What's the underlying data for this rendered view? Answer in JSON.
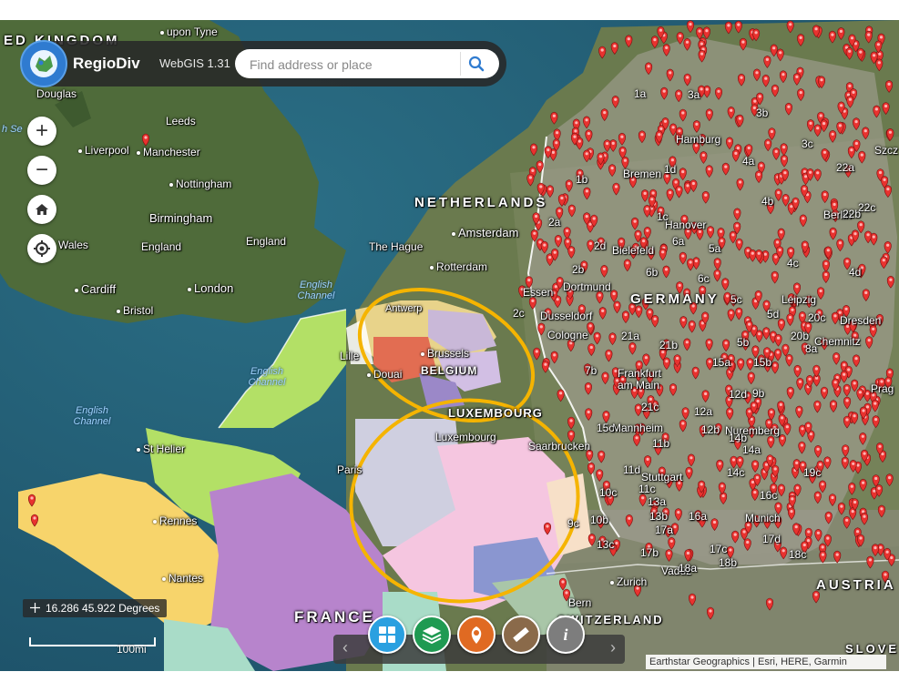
{
  "app": {
    "title": "RegioDiv",
    "version": "WebGIS 1.31"
  },
  "search": {
    "placeholder": "Find address or place"
  },
  "controls": {
    "zoom_in": "+",
    "zoom_out": "−"
  },
  "status": {
    "coordinates": "16.286 45.922 Degrees",
    "scale": "100mi"
  },
  "attribution": "Earthstar Geographics | Esri, HERE, Garmin",
  "countries": [
    "ED KINGDOM",
    "NETHERLANDS",
    "BELGIUM",
    "LUXEMBOURG",
    "GERMANY",
    "FRANCE",
    "AUSTRIA",
    "SWITZERLAND",
    "SLOVE"
  ],
  "seas": [
    "English Channel",
    "English Channel",
    "English Channel",
    "h Se"
  ],
  "cities": [
    "upon Tyne",
    "Douglas",
    "Leeds",
    "Liverpool",
    "Manchester",
    "Nottingham",
    "Birmingham",
    "Wales",
    "England",
    "England",
    "Cardiff",
    "Bristol",
    "London",
    "Amsterdam",
    "The Hague",
    "Rotterdam",
    "Antwerp",
    "Brussels",
    "Lille",
    "Douai",
    "Luxembourg",
    "Paris",
    "St Helier",
    "Rennes",
    "Nantes",
    "Hamburg",
    "Bremen",
    "Hanover",
    "Bielefeld",
    "Berlin",
    "Essen",
    "Dortmund",
    "Dusseldorf",
    "Cologne",
    "Frankfurt am Main",
    "Mannheim",
    "Saarbrucken",
    "Stuttgart",
    "Nuremberg",
    "Munich",
    "Leipzig",
    "Dresden",
    "Chemnitz",
    "Zurich",
    "Vaduz",
    "Bern",
    "Prag",
    "Szcz"
  ],
  "region_labels": [
    "1a",
    "3a",
    "3b",
    "3c",
    "1d",
    "1b",
    "4a",
    "22a",
    "4b",
    "22c",
    "2a",
    "1c",
    "6a",
    "2d",
    "5a",
    "2b",
    "6b",
    "4c",
    "4d",
    "6c",
    "5c",
    "2c",
    "5d",
    "20c",
    "21a",
    "21b",
    "5b",
    "20b",
    "8a",
    "7b",
    "15a",
    "15b",
    "12d",
    "15c",
    "9b",
    "21c",
    "12a",
    "12b",
    "14b",
    "11b",
    "14a",
    "11d",
    "14c",
    "19c",
    "10c",
    "11c",
    "16c",
    "13a",
    "13b",
    "16a",
    "10b",
    "17a",
    "17d",
    "13c",
    "17b",
    "17c",
    "18c",
    "18a",
    "18b",
    "9c",
    "22b"
  ],
  "toolbar": {
    "info_label": "i"
  },
  "colors": {
    "pin": "#e8322f",
    "highlight": "#f5b400",
    "header": "#282828",
    "zoom_icon": "#333333"
  },
  "icons": [
    "logo-icon",
    "search-icon",
    "home-icon",
    "locate-icon",
    "crosshair-icon",
    "grid-icon",
    "layers-icon",
    "pin-tool-icon",
    "ruler-icon",
    "info-icon",
    "chevron-left-icon",
    "chevron-right-icon"
  ]
}
